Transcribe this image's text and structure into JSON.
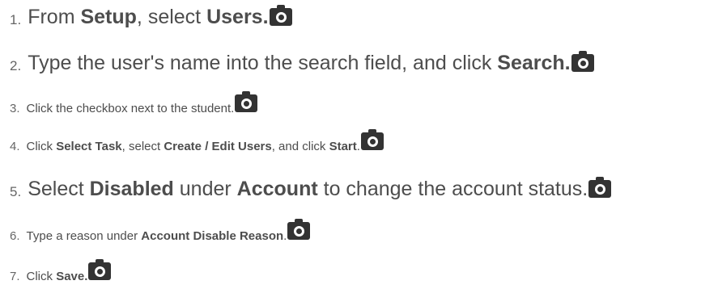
{
  "steps": [
    {
      "number": "1.",
      "parts": [
        {
          "text": "From ",
          "bold": false
        },
        {
          "text": "Setup",
          "bold": true
        },
        {
          "text": ", select ",
          "bold": false
        },
        {
          "text": "Users.",
          "bold": true
        }
      ],
      "icon": "camera-icon"
    },
    {
      "number": "2.",
      "parts": [
        {
          "text": "Type the user's name into the search field, and click ",
          "bold": false
        },
        {
          "text": "Search.",
          "bold": true
        }
      ],
      "icon": "camera-icon"
    },
    {
      "number": "3.",
      "parts": [
        {
          "text": "Click the checkbox next to the student.",
          "bold": false
        }
      ],
      "icon": "camera-icon"
    },
    {
      "number": "4.",
      "parts": [
        {
          "text": "Click ",
          "bold": false
        },
        {
          "text": "Select Task",
          "bold": true
        },
        {
          "text": ", select ",
          "bold": false
        },
        {
          "text": "Create / Edit Users",
          "bold": true
        },
        {
          "text": ", and click ",
          "bold": false
        },
        {
          "text": "Start",
          "bold": true
        },
        {
          "text": ".",
          "bold": false
        }
      ],
      "icon": "camera-icon"
    },
    {
      "number": "5.",
      "parts": [
        {
          "text": "Select ",
          "bold": false
        },
        {
          "text": "Disabled",
          "bold": true
        },
        {
          "text": " under ",
          "bold": false
        },
        {
          "text": "Account",
          "bold": true
        },
        {
          "text": " to change the account status.",
          "bold": false
        }
      ],
      "icon": "camera-icon"
    },
    {
      "number": "6.",
      "parts": [
        {
          "text": "Type a reason under ",
          "bold": false
        },
        {
          "text": "Account Disable Reason",
          "bold": true
        },
        {
          "text": ".",
          "bold": false
        }
      ],
      "icon": "camera-icon"
    },
    {
      "number": "7.",
      "parts": [
        {
          "text": "Click ",
          "bold": false
        },
        {
          "text": "Save.",
          "bold": true
        }
      ],
      "icon": "camera-icon"
    }
  ]
}
